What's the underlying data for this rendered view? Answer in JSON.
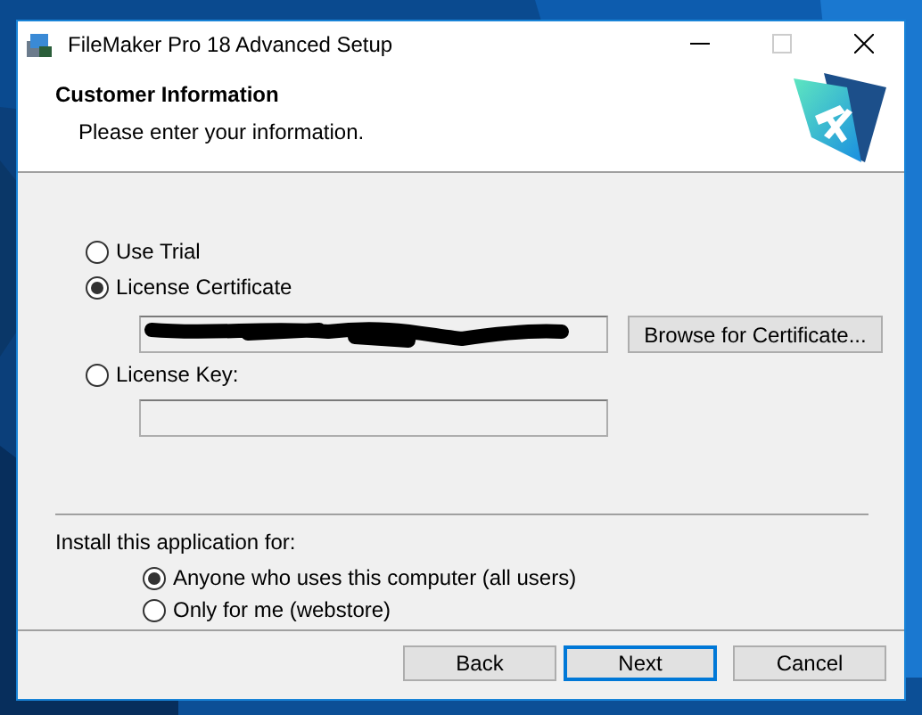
{
  "window": {
    "title": "FileMaker Pro 18 Advanced Setup"
  },
  "header": {
    "title": "Customer Information",
    "subtitle": "Please enter your information."
  },
  "license_options": [
    {
      "label": "Use Trial",
      "selected": false
    },
    {
      "label": "License Certificate",
      "selected": true
    },
    {
      "label": "License Key:",
      "selected": false
    }
  ],
  "certificate_field": {
    "redacted": true
  },
  "browse_button": "Browse for Certificate...",
  "install_for": {
    "label": "Install this application for:",
    "options": [
      {
        "label": "Anyone who uses this computer (all users)",
        "selected": true
      },
      {
        "label": "Only for me (webstore)",
        "selected": false
      }
    ]
  },
  "buttons": [
    {
      "label": "Back",
      "default": false
    },
    {
      "label": "Next",
      "default": true
    },
    {
      "label": "Cancel",
      "default": false
    }
  ]
}
